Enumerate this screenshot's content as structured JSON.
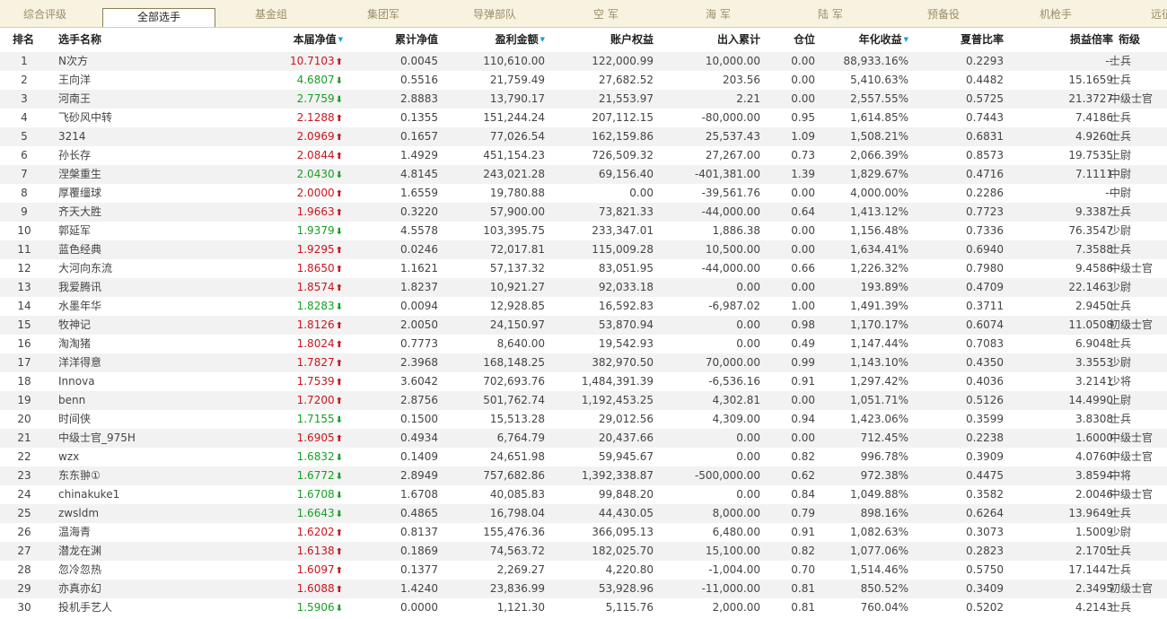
{
  "tabs": [
    {
      "label": "综合评级",
      "active": false
    },
    {
      "label": "全部选手",
      "active": true
    },
    {
      "label": "基金组",
      "active": false
    },
    {
      "label": "集团军",
      "active": false
    },
    {
      "label": "导弹部队",
      "active": false
    },
    {
      "label": "空 军",
      "active": false
    },
    {
      "label": "海 军",
      "active": false
    },
    {
      "label": "陆 军",
      "active": false
    },
    {
      "label": "预备役",
      "active": false
    },
    {
      "label": "机枪手",
      "active": false
    },
    {
      "label": "远征",
      "active": false
    }
  ],
  "columns": {
    "rank": "排名",
    "name": "选手名称",
    "nav": "本届净值",
    "cum_nav": "累计净值",
    "profit": "盈利金额",
    "equity": "账户权益",
    "flow": "出入累计",
    "position": "仓位",
    "annual": "年化收益",
    "sharpe": "夏普比率",
    "pl_ratio": "损益倍率",
    "rankname": "衔级"
  },
  "sorted_columns": [
    "nav",
    "profit",
    "annual"
  ],
  "colors": {
    "up": "#c8161d",
    "down": "#17a023",
    "sort_indicator": "#1aa0c9"
  },
  "rows": [
    {
      "rank": "1",
      "name": "N次方",
      "nav": "10.7103",
      "dir": "up",
      "cum_nav": "0.0045",
      "profit": "110,610.00",
      "equity": "122,000.99",
      "flow": "10,000.00",
      "position": "0.00",
      "annual": "88,933.16%",
      "sharpe": "0.2293",
      "pl_ratio": "--",
      "rankname": "士兵"
    },
    {
      "rank": "2",
      "name": "王向洋",
      "nav": "4.6807",
      "dir": "down",
      "cum_nav": "0.5516",
      "profit": "21,759.49",
      "equity": "27,682.52",
      "flow": "203.56",
      "position": "0.00",
      "annual": "5,410.63%",
      "sharpe": "0.4482",
      "pl_ratio": "15.1659",
      "rankname": "士兵"
    },
    {
      "rank": "3",
      "name": "河南王",
      "nav": "2.7759",
      "dir": "down",
      "cum_nav": "2.8883",
      "profit": "13,790.17",
      "equity": "21,553.97",
      "flow": "2.21",
      "position": "0.00",
      "annual": "2,557.55%",
      "sharpe": "0.5725",
      "pl_ratio": "21.3727",
      "rankname": "中级士官"
    },
    {
      "rank": "4",
      "name": "飞砂风中转",
      "nav": "2.1288",
      "dir": "up",
      "cum_nav": "0.1355",
      "profit": "151,244.24",
      "equity": "207,112.15",
      "flow": "-80,000.00",
      "position": "0.95",
      "annual": "1,614.85%",
      "sharpe": "0.7443",
      "pl_ratio": "7.4186",
      "rankname": "士兵"
    },
    {
      "rank": "5",
      "name": "3214",
      "nav": "2.0969",
      "dir": "up",
      "cum_nav": "0.1657",
      "profit": "77,026.54",
      "equity": "162,159.86",
      "flow": "25,537.43",
      "position": "1.09",
      "annual": "1,508.21%",
      "sharpe": "0.6831",
      "pl_ratio": "4.9260",
      "rankname": "士兵"
    },
    {
      "rank": "6",
      "name": "孙长存",
      "nav": "2.0844",
      "dir": "up",
      "cum_nav": "1.4929",
      "profit": "451,154.23",
      "equity": "726,509.32",
      "flow": "27,267.00",
      "position": "0.73",
      "annual": "2,066.39%",
      "sharpe": "0.8573",
      "pl_ratio": "19.7535",
      "rankname": "上尉"
    },
    {
      "rank": "7",
      "name": "涅槃重生",
      "nav": "2.0430",
      "dir": "down",
      "cum_nav": "4.8145",
      "profit": "243,021.28",
      "equity": "69,156.40",
      "flow": "-401,381.00",
      "position": "1.39",
      "annual": "1,829.67%",
      "sharpe": "0.4716",
      "pl_ratio": "7.1111",
      "rankname": "中尉"
    },
    {
      "rank": "8",
      "name": "厚覆缰球",
      "nav": "2.0000",
      "dir": "up",
      "cum_nav": "1.6559",
      "profit": "19,780.88",
      "equity": "0.00",
      "flow": "-39,561.76",
      "position": "0.00",
      "annual": "4,000.00%",
      "sharpe": "0.2286",
      "pl_ratio": "--",
      "rankname": "中尉"
    },
    {
      "rank": "9",
      "name": "齐天大胜",
      "nav": "1.9663",
      "dir": "up",
      "cum_nav": "0.3220",
      "profit": "57,900.00",
      "equity": "73,821.33",
      "flow": "-44,000.00",
      "position": "0.64",
      "annual": "1,413.12%",
      "sharpe": "0.7723",
      "pl_ratio": "9.3387",
      "rankname": "士兵"
    },
    {
      "rank": "10",
      "name": "郭延军",
      "nav": "1.9379",
      "dir": "down",
      "cum_nav": "4.5578",
      "profit": "103,395.75",
      "equity": "233,347.01",
      "flow": "1,886.38",
      "position": "0.00",
      "annual": "1,156.48%",
      "sharpe": "0.7336",
      "pl_ratio": "76.3547",
      "rankname": "少尉"
    },
    {
      "rank": "11",
      "name": "蓝色经典",
      "nav": "1.9295",
      "dir": "up",
      "cum_nav": "0.0246",
      "profit": "72,017.81",
      "equity": "115,009.28",
      "flow": "10,500.00",
      "position": "0.00",
      "annual": "1,634.41%",
      "sharpe": "0.6940",
      "pl_ratio": "7.3588",
      "rankname": "士兵"
    },
    {
      "rank": "12",
      "name": "大河向东流",
      "nav": "1.8650",
      "dir": "up",
      "cum_nav": "1.1621",
      "profit": "57,137.32",
      "equity": "83,051.95",
      "flow": "-44,000.00",
      "position": "0.66",
      "annual": "1,226.32%",
      "sharpe": "0.7980",
      "pl_ratio": "9.4586",
      "rankname": "中级士官"
    },
    {
      "rank": "13",
      "name": "我爱腾讯",
      "nav": "1.8574",
      "dir": "up",
      "cum_nav": "1.8237",
      "profit": "10,921.27",
      "equity": "92,033.18",
      "flow": "0.00",
      "position": "0.00",
      "annual": "193.89%",
      "sharpe": "0.4709",
      "pl_ratio": "22.1463",
      "rankname": "少尉"
    },
    {
      "rank": "14",
      "name": "水墨年华",
      "nav": "1.8283",
      "dir": "down",
      "cum_nav": "0.0094",
      "profit": "12,928.85",
      "equity": "16,592.83",
      "flow": "-6,987.02",
      "position": "1.00",
      "annual": "1,491.39%",
      "sharpe": "0.3711",
      "pl_ratio": "2.9450",
      "rankname": "士兵"
    },
    {
      "rank": "15",
      "name": "牧神记",
      "nav": "1.8126",
      "dir": "up",
      "cum_nav": "2.0050",
      "profit": "24,150.97",
      "equity": "53,870.94",
      "flow": "0.00",
      "position": "0.98",
      "annual": "1,170.17%",
      "sharpe": "0.6074",
      "pl_ratio": "11.0508",
      "rankname": "初级士官"
    },
    {
      "rank": "16",
      "name": "淘淘猪",
      "nav": "1.8024",
      "dir": "up",
      "cum_nav": "0.7773",
      "profit": "8,640.00",
      "equity": "19,542.93",
      "flow": "0.00",
      "position": "0.49",
      "annual": "1,147.44%",
      "sharpe": "0.7083",
      "pl_ratio": "6.9048",
      "rankname": "士兵"
    },
    {
      "rank": "17",
      "name": "洋洋得意",
      "nav": "1.7827",
      "dir": "up",
      "cum_nav": "2.3968",
      "profit": "168,148.25",
      "equity": "382,970.50",
      "flow": "70,000.00",
      "position": "0.99",
      "annual": "1,143.10%",
      "sharpe": "0.4350",
      "pl_ratio": "3.3553",
      "rankname": "少尉"
    },
    {
      "rank": "18",
      "name": "Innova",
      "nav": "1.7539",
      "dir": "up",
      "cum_nav": "3.6042",
      "profit": "702,693.76",
      "equity": "1,484,391.39",
      "flow": "-6,536.16",
      "position": "0.91",
      "annual": "1,297.42%",
      "sharpe": "0.4036",
      "pl_ratio": "3.2141",
      "rankname": "少将"
    },
    {
      "rank": "19",
      "name": "benn",
      "nav": "1.7200",
      "dir": "up",
      "cum_nav": "2.8756",
      "profit": "501,762.74",
      "equity": "1,192,453.25",
      "flow": "4,302.81",
      "position": "0.00",
      "annual": "1,051.71%",
      "sharpe": "0.5126",
      "pl_ratio": "14.4990",
      "rankname": "上尉"
    },
    {
      "rank": "20",
      "name": "时间侠",
      "nav": "1.7155",
      "dir": "down",
      "cum_nav": "0.1500",
      "profit": "15,513.28",
      "equity": "29,012.56",
      "flow": "4,309.00",
      "position": "0.94",
      "annual": "1,423.06%",
      "sharpe": "0.3599",
      "pl_ratio": "3.8308",
      "rankname": "士兵"
    },
    {
      "rank": "21",
      "name": "中级士官_975H",
      "nav": "1.6905",
      "dir": "up",
      "cum_nav": "0.4934",
      "profit": "6,764.79",
      "equity": "20,437.66",
      "flow": "0.00",
      "position": "0.00",
      "annual": "712.45%",
      "sharpe": "0.2238",
      "pl_ratio": "1.6000",
      "rankname": "中级士官"
    },
    {
      "rank": "22",
      "name": "wzx",
      "nav": "1.6832",
      "dir": "down",
      "cum_nav": "0.1409",
      "profit": "24,651.98",
      "equity": "59,945.67",
      "flow": "0.00",
      "position": "0.82",
      "annual": "996.78%",
      "sharpe": "0.3909",
      "pl_ratio": "4.0760",
      "rankname": "中级士官"
    },
    {
      "rank": "23",
      "name": "东东翀①",
      "nav": "1.6772",
      "dir": "down",
      "cum_nav": "2.8949",
      "profit": "757,682.86",
      "equity": "1,392,338.87",
      "flow": "-500,000.00",
      "position": "0.62",
      "annual": "972.38%",
      "sharpe": "0.4475",
      "pl_ratio": "3.8594",
      "rankname": "中将"
    },
    {
      "rank": "24",
      "name": "chinakuke1",
      "nav": "1.6708",
      "dir": "down",
      "cum_nav": "1.6708",
      "profit": "40,085.83",
      "equity": "99,848.20",
      "flow": "0.00",
      "position": "0.84",
      "annual": "1,049.88%",
      "sharpe": "0.3582",
      "pl_ratio": "2.0046",
      "rankname": "中级士官"
    },
    {
      "rank": "25",
      "name": "zwsldm",
      "nav": "1.6643",
      "dir": "down",
      "cum_nav": "0.4865",
      "profit": "16,798.04",
      "equity": "44,430.05",
      "flow": "8,000.00",
      "position": "0.79",
      "annual": "898.16%",
      "sharpe": "0.6264",
      "pl_ratio": "13.9649",
      "rankname": "士兵"
    },
    {
      "rank": "26",
      "name": "温海青",
      "nav": "1.6202",
      "dir": "up",
      "cum_nav": "0.8137",
      "profit": "155,476.36",
      "equity": "366,095.13",
      "flow": "6,480.00",
      "position": "0.91",
      "annual": "1,082.63%",
      "sharpe": "0.3073",
      "pl_ratio": "1.5009",
      "rankname": "少尉"
    },
    {
      "rank": "27",
      "name": "潜龙在渊",
      "nav": "1.6138",
      "dir": "up",
      "cum_nav": "0.1869",
      "profit": "74,563.72",
      "equity": "182,025.70",
      "flow": "15,100.00",
      "position": "0.82",
      "annual": "1,077.06%",
      "sharpe": "0.2823",
      "pl_ratio": "2.1705",
      "rankname": "士兵"
    },
    {
      "rank": "28",
      "name": "忽冷忽热",
      "nav": "1.6097",
      "dir": "up",
      "cum_nav": "0.1377",
      "profit": "2,269.27",
      "equity": "4,220.80",
      "flow": "-1,004.00",
      "position": "0.70",
      "annual": "1,514.46%",
      "sharpe": "0.5750",
      "pl_ratio": "17.1447",
      "rankname": "士兵"
    },
    {
      "rank": "29",
      "name": "亦真亦幻",
      "nav": "1.6088",
      "dir": "up",
      "cum_nav": "1.4240",
      "profit": "23,836.99",
      "equity": "53,928.96",
      "flow": "-11,000.00",
      "position": "0.81",
      "annual": "850.52%",
      "sharpe": "0.3409",
      "pl_ratio": "2.3495",
      "rankname": "初级士官"
    },
    {
      "rank": "30",
      "name": "投机手艺人",
      "nav": "1.5906",
      "dir": "down",
      "cum_nav": "0.0000",
      "profit": "1,121.30",
      "equity": "5,115.76",
      "flow": "2,000.00",
      "position": "0.81",
      "annual": "760.04%",
      "sharpe": "0.5202",
      "pl_ratio": "4.2143",
      "rankname": "士兵"
    }
  ]
}
